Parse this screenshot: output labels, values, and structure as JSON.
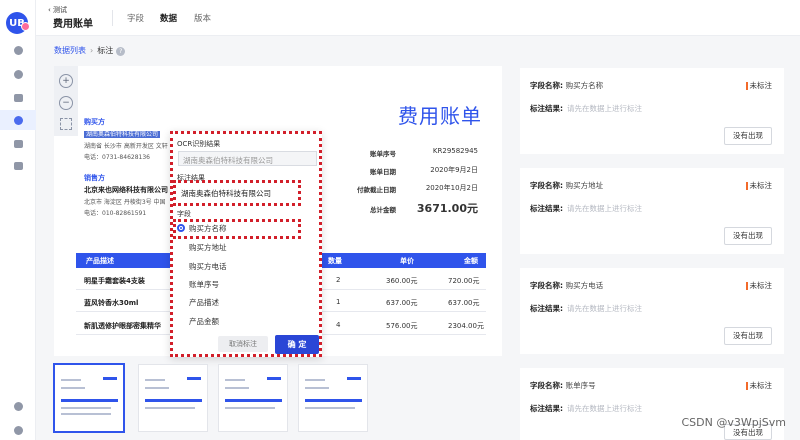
{
  "header": {
    "back_label": "测试",
    "title": "费用账单",
    "tabs": [
      "字段",
      "数据",
      "版本"
    ]
  },
  "breadcrumb": {
    "list": "数据列表",
    "separator": "›",
    "current": "标注",
    "help_icon": "question-icon"
  },
  "document": {
    "title": "费用账单",
    "buyer_label": "购买方",
    "buyer_highlight": "湖南奥森伯特科技有限公司",
    "buyer_addr": "湖南省 长沙市 高新开发区 文轩",
    "buyer_phone": "电话：0731-84628136",
    "seller_label": "销售方",
    "seller_name": "北京来也网络科技有限公司",
    "seller_addr": "北京市 海淀区 丹棱街3号 中国",
    "seller_phone": "电话：010-82861591",
    "invoice_no_label": "账单序号",
    "invoice_no": "KR29582945",
    "bill_date_label": "账单日期",
    "bill_date": "2020年9月2日",
    "due_date_label": "付款截止日期",
    "due_date": "2020年10月2日",
    "total_label": "总计金额",
    "total": "3671.00元",
    "table": {
      "headers": [
        "产品描述",
        "数量",
        "单价",
        "金额"
      ],
      "rows": [
        [
          "明星手霜套装4支装",
          "2",
          "360.00元",
          "720.00元"
        ],
        [
          "蓝风铃香水30ml",
          "1",
          "637.00元",
          "637.00元"
        ],
        [
          "新肌透修护眼部密集精华",
          "4",
          "576.00元",
          "2304.00元"
        ]
      ]
    }
  },
  "popup": {
    "ocr_label": "OCR识别结果",
    "ocr_value": "湖南奥森伯特科技有限公司",
    "result_label": "标注结果",
    "result_value": "湖南奥森伯特科技有限公司",
    "field_label": "字段",
    "options": [
      "购买方名称",
      "购买方地址",
      "购买方电话",
      "账单序号",
      "产品描述",
      "产品金额"
    ],
    "cancel": "取消标注",
    "confirm": "确 定"
  },
  "cards": [
    {
      "name_label": "字段名称:",
      "name": "购买方名称",
      "status": "未标注",
      "result_label": "标注结果:",
      "result_placeholder": "请先在数据上进行标注",
      "button": "没有出现"
    },
    {
      "name_label": "字段名称:",
      "name": "购买方地址",
      "status": "未标注",
      "result_label": "标注结果:",
      "result_placeholder": "请先在数据上进行标注",
      "button": "没有出现"
    },
    {
      "name_label": "字段名称:",
      "name": "购买方电话",
      "status": "未标注",
      "result_label": "标注结果:",
      "result_placeholder": "请先在数据上进行标注",
      "button": "没有出现"
    },
    {
      "name_label": "字段名称:",
      "name": "账单序号",
      "status": "未标注",
      "result_label": "标注结果:",
      "result_placeholder": "请先在数据上进行标注",
      "button": "没有出现"
    }
  ],
  "watermark": "CSDN @v3WpjSvm",
  "colors": {
    "accent": "#2f54eb",
    "annotation_outline": "#d21f2a",
    "status_bar": "#f26a2b"
  }
}
